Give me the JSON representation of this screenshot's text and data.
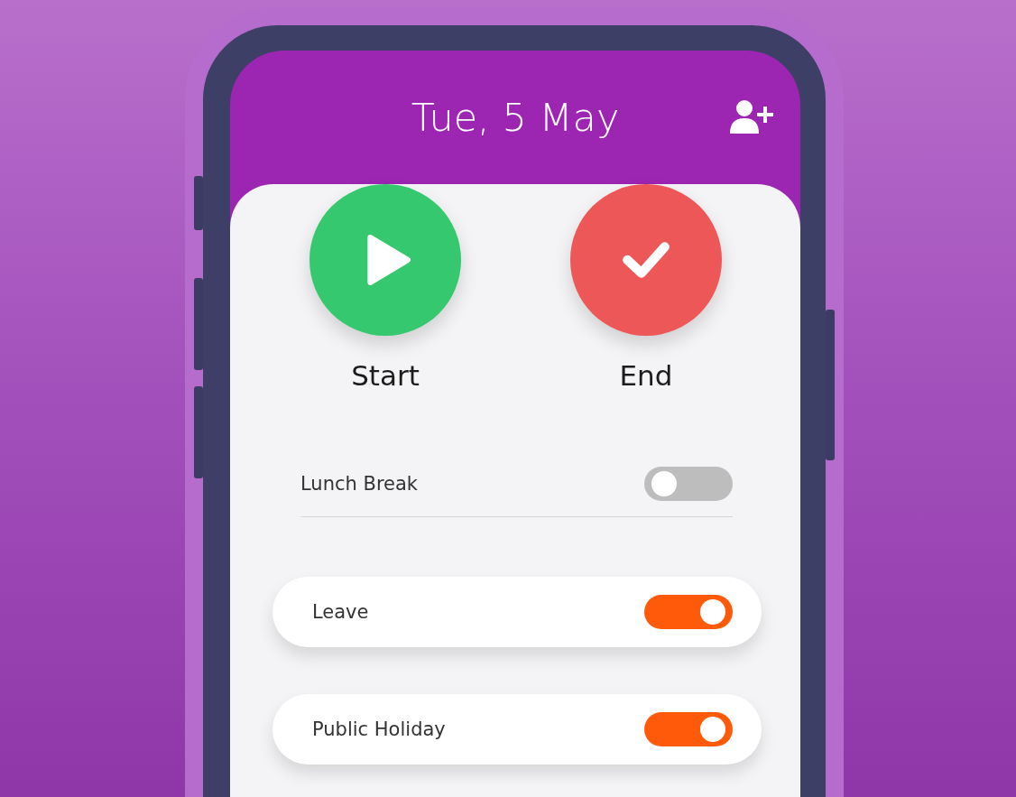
{
  "header": {
    "title": "Tue, 5 May"
  },
  "actions": [
    {
      "kind": "start",
      "label": "Start"
    },
    {
      "kind": "end",
      "label": "End"
    }
  ],
  "settings": [
    {
      "kind": "plain",
      "label": "Lunch Break",
      "on": false
    },
    {
      "kind": "card",
      "label": "Leave",
      "on": true
    },
    {
      "kind": "card",
      "label": "Public Holiday",
      "on": true
    }
  ]
}
